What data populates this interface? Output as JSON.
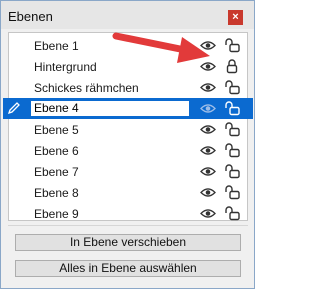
{
  "panel": {
    "title": "Ebenen",
    "close_symbol": "×"
  },
  "layers": [
    {
      "name": "Ebene 1",
      "visible": true,
      "locked": false,
      "selected": false
    },
    {
      "name": "Hintergrund",
      "visible": true,
      "locked": true,
      "selected": false
    },
    {
      "name": "Schickes rähmchen",
      "visible": true,
      "locked": false,
      "selected": false
    },
    {
      "name": "Ebene 4",
      "visible": true,
      "locked": false,
      "selected": true
    },
    {
      "name": "Ebene 5",
      "visible": true,
      "locked": false,
      "selected": false
    },
    {
      "name": "Ebene 6",
      "visible": true,
      "locked": false,
      "selected": false
    },
    {
      "name": "Ebene 7",
      "visible": true,
      "locked": false,
      "selected": false
    },
    {
      "name": "Ebene 8",
      "visible": true,
      "locked": false,
      "selected": false
    },
    {
      "name": "Ebene 9",
      "visible": true,
      "locked": false,
      "selected": false
    }
  ],
  "buttons": {
    "move_to_layer": "In Ebene verschieben",
    "select_all_in_layer": "Alles in Ebene auswählen"
  },
  "icons": {
    "visibility": "eye-icon",
    "lock_open": "lock-open-icon",
    "lock_closed": "lock-closed-icon",
    "edit": "pencil-icon",
    "annotation": "red-arrow-annotation"
  },
  "colors": {
    "selection": "#0b6ad0",
    "close_button": "#c9392d",
    "annotation_arrow": "#e23a3a"
  }
}
